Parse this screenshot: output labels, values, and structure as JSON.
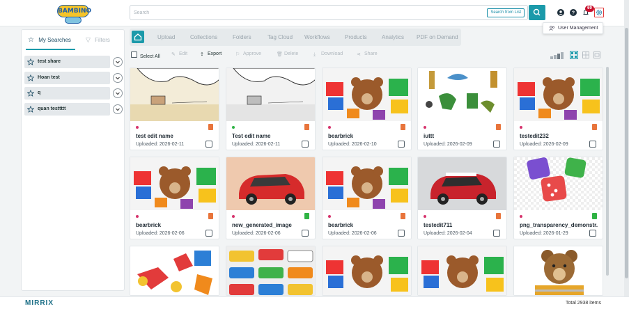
{
  "app": {
    "logo_text": "BAMBINO",
    "footer_logo": "MIRRIX",
    "total_items": "Total 2938 items"
  },
  "search": {
    "placeholder": "Search",
    "value": "",
    "search_from_list_label": "Search from List"
  },
  "header": {
    "notification_count": "69"
  },
  "user_menu": {
    "item_label": "User Management"
  },
  "sidebar": {
    "tabs": [
      {
        "label": "My Searches",
        "active": true
      },
      {
        "label": "Filters",
        "active": false
      }
    ],
    "saved_searches": [
      {
        "label": "test share"
      },
      {
        "label": "Hoan test"
      },
      {
        "label": "q"
      },
      {
        "label": "quan testtttt"
      }
    ]
  },
  "main_tabs": [
    "Upload",
    "Collections",
    "Folders",
    "Tag Cloud",
    "Workflows",
    "Products",
    "Analytics",
    "PDF on Demand"
  ],
  "toolbar": {
    "select_all": "Select All",
    "edit": "Edit",
    "export": "Export",
    "approve": "Approve",
    "delete": "Delete",
    "download": "Download",
    "share": "Share"
  },
  "assets": [
    {
      "name": "test edit name",
      "uploaded": "Uploaded: 2026-02-11",
      "status_color": "#d6336c",
      "file_color": "#e8743b",
      "thumb": "sketch"
    },
    {
      "name": "Test edit name",
      "uploaded": "Uploaded: 2026-02-11",
      "status_color": "#2fb344",
      "file_color": "#e8743b",
      "thumb": "sketch"
    },
    {
      "name": "bearbrick",
      "uploaded": "Uploaded: 2026-02-10",
      "status_color": "#d6336c",
      "file_color": "#e8743b",
      "thumb": "toys"
    },
    {
      "name": "iuttt",
      "uploaded": "Uploaded: 2026-02-09",
      "status_color": "#d6336c",
      "file_color": "#e8743b",
      "thumb": "figures"
    },
    {
      "name": "testedit232",
      "uploaded": "Uploaded: 2026-02-09",
      "status_color": "#d6336c",
      "file_color": "#e8743b",
      "thumb": "toys"
    },
    {
      "name": "bearbrick",
      "uploaded": "Uploaded: 2026-02-06",
      "status_color": "#d6336c",
      "file_color": "#e8743b",
      "thumb": "toys"
    },
    {
      "name": "new_generated_image",
      "uploaded": "Uploaded: 2026-02-06",
      "status_color": "#d6336c",
      "file_color": "#2fb344",
      "thumb": "car-peach"
    },
    {
      "name": "bearbrick",
      "uploaded": "Uploaded: 2026-02-06",
      "status_color": "#d6336c",
      "file_color": "#e8743b",
      "thumb": "toys"
    },
    {
      "name": "testedit711",
      "uploaded": "Uploaded: 2026-02-04",
      "status_color": "#d6336c",
      "file_color": "#e8743b",
      "thumb": "car-grey"
    },
    {
      "name": "png_transparency_demonstr...",
      "uploaded": "Uploaded: 2026-01-29",
      "status_color": "#d6336c",
      "file_color": "#2fb344",
      "thumb": "dice"
    }
  ]
}
